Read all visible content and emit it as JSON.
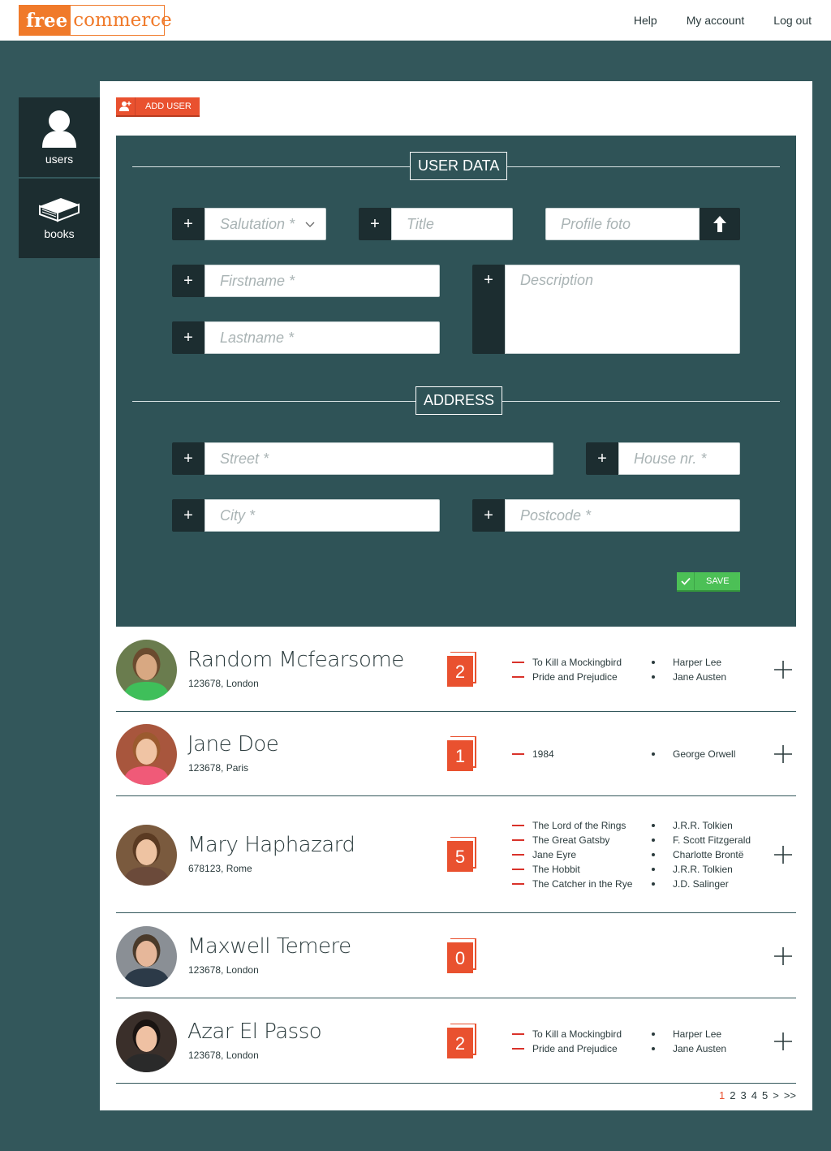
{
  "brand": {
    "part1": "free",
    "part2": "commerce"
  },
  "topnav": {
    "help": "Help",
    "account": "My account",
    "logout": "Log out"
  },
  "sidebar": {
    "users": "users",
    "books": "books"
  },
  "toolbar": {
    "add_user": "ADD USER"
  },
  "form": {
    "user_data_title": "USER DATA",
    "address_title": "ADDRESS",
    "salutation_placeholder": "Salutation *",
    "title_placeholder": "Title",
    "profile_placeholder": "Profile foto",
    "firstname_placeholder": "Firstname *",
    "lastname_placeholder": "Lastname *",
    "description_placeholder": "Description",
    "street_placeholder": "Street *",
    "house_placeholder": "House nr. *",
    "city_placeholder": "City *",
    "postcode_placeholder": "Postcode *",
    "save": "SAVE"
  },
  "users": [
    {
      "name": "Random Mcfearsome",
      "address": "123678, London",
      "count": "2",
      "books": [
        "To Kill a Mockingbird",
        "Pride and Prejudice"
      ],
      "authors": [
        "Harper Lee",
        "Jane Austen"
      ]
    },
    {
      "name": "Jane Doe",
      "address": "123678, Paris",
      "count": "1",
      "books": [
        "1984"
      ],
      "authors": [
        "George Orwell"
      ]
    },
    {
      "name": "Mary Haphazard",
      "address": "678123, Rome",
      "count": "5",
      "books": [
        "The Lord of the Rings",
        "The Great Gatsby",
        "Jane Eyre",
        "The Hobbit",
        "The Catcher in the Rye"
      ],
      "authors": [
        "J.R.R. Tolkien",
        "F. Scott Fitzgerald",
        "Charlotte Brontë",
        "J.R.R. Tolkien",
        "J.D. Salinger"
      ]
    },
    {
      "name": "Maxwell Temere",
      "address": "123678, London",
      "count": "0",
      "books": [],
      "authors": []
    },
    {
      "name": "Azar El Passo",
      "address": "123678, London",
      "count": "2",
      "books": [
        "To Kill a Mockingbird",
        "Pride and Prejudice"
      ],
      "authors": [
        "Harper Lee",
        "Jane Austen"
      ]
    }
  ],
  "pagination": {
    "pages": [
      "1",
      "2",
      "3",
      "4",
      "5"
    ],
    "next": ">",
    "last": ">>",
    "current": "1"
  },
  "colors": {
    "accent": "#e9512f",
    "brand": "#f07a2a",
    "dark": "#1c2d30",
    "panel": "#2f5357",
    "save": "#4cc056"
  }
}
